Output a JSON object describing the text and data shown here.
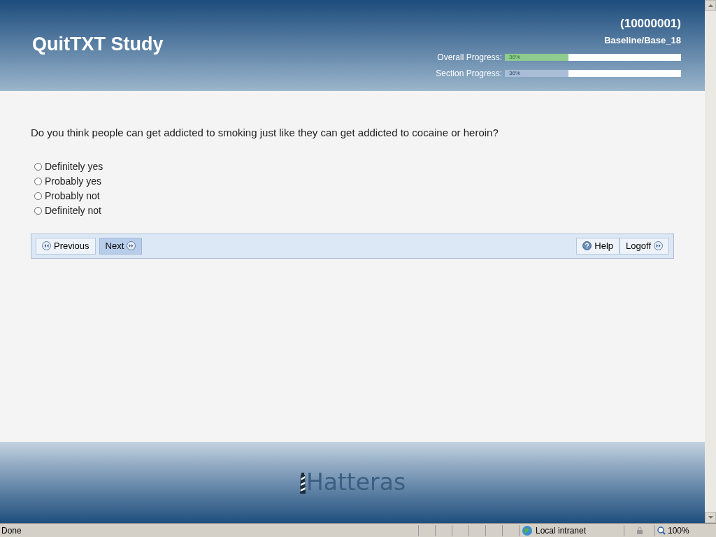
{
  "header": {
    "title": "QuitTXT Study",
    "participant_id": "(10000001)",
    "section": "Baseline/Base_18",
    "progress": [
      {
        "label": "Overall Progress:",
        "reading": "36%",
        "level": 0.36,
        "kind": "overall"
      },
      {
        "label": "Section Progress:",
        "reading": "36%",
        "level": 0.36,
        "kind": "section"
      }
    ]
  },
  "question": {
    "text": "Do you think people can get addicted to smoking just like they can get addicted to cocaine or heroin?",
    "options": [
      {
        "label": "Definitely yes",
        "selected": false
      },
      {
        "label": "Probably yes",
        "selected": false
      },
      {
        "label": "Probably not",
        "selected": false
      },
      {
        "label": "Definitely not",
        "selected": false
      }
    ]
  },
  "nav": {
    "left": [
      {
        "label": "Previous",
        "kind": "previous",
        "highlighted": false
      },
      {
        "label": "Next",
        "kind": "next",
        "highlighted": true
      }
    ],
    "right": [
      {
        "label": "Help",
        "kind": "help",
        "highlighted": false
      },
      {
        "label": "Logoff",
        "kind": "logoff",
        "highlighted": false
      }
    ]
  },
  "footer": {
    "logo": "Hatteras"
  },
  "status_bar": {
    "status": "Done",
    "zone": "Local intranet",
    "zoom": "100%"
  }
}
